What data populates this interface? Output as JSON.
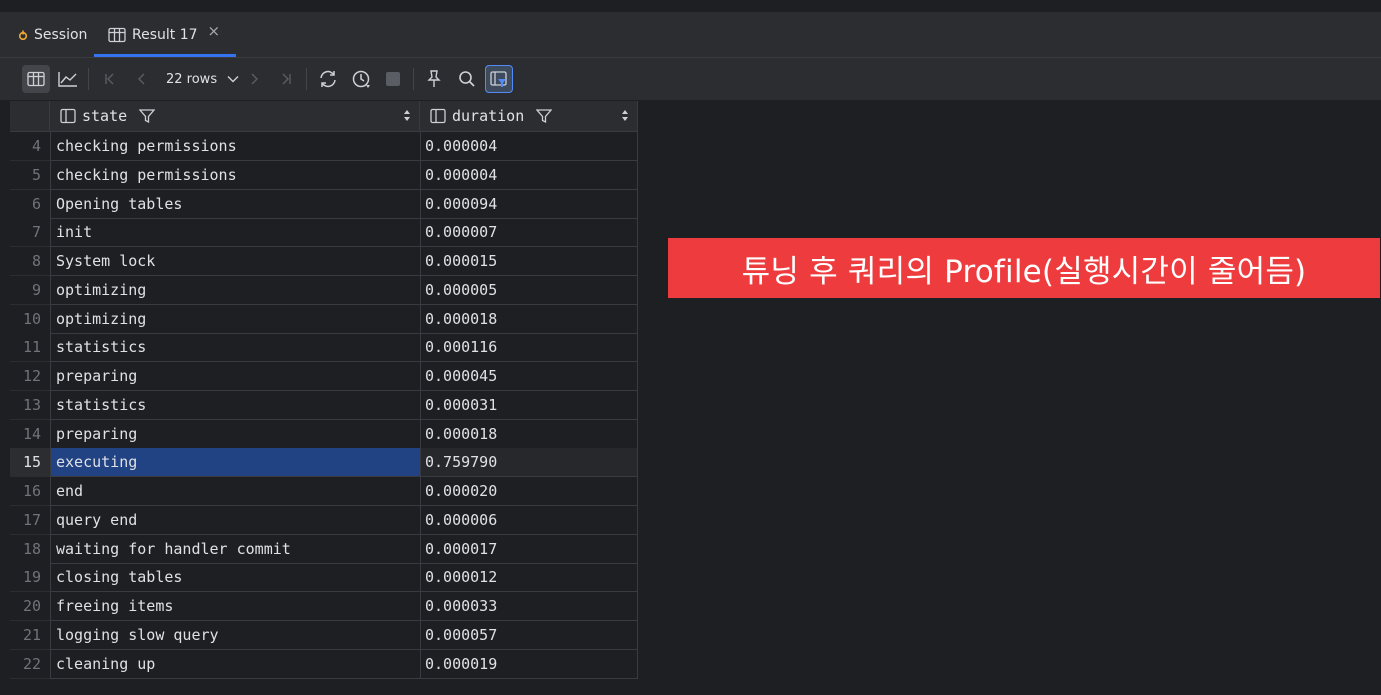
{
  "tabs": [
    {
      "label": "Session",
      "icon": "session-icon"
    },
    {
      "label": "Result 17",
      "icon": "table-icon",
      "close": "×"
    }
  ],
  "toolbar": {
    "rows_label": "22 rows",
    "icons": [
      "table-view-icon",
      "chart-view-icon",
      "first-page-icon",
      "prev-page-icon",
      "next-page-icon",
      "last-page-icon",
      "refresh-icon",
      "history-icon",
      "stop-icon",
      "pin-icon",
      "search-icon",
      "filter-panel-icon"
    ]
  },
  "grid": {
    "columns": [
      {
        "label": "state"
      },
      {
        "label": "duration"
      }
    ],
    "selected_row": "15",
    "rows": [
      {
        "num": "4",
        "state": "checking permissions",
        "duration": "0.000004"
      },
      {
        "num": "5",
        "state": "checking permissions",
        "duration": "0.000004"
      },
      {
        "num": "6",
        "state": "Opening tables",
        "duration": "0.000094"
      },
      {
        "num": "7",
        "state": "init",
        "duration": "0.000007"
      },
      {
        "num": "8",
        "state": "System lock",
        "duration": "0.000015"
      },
      {
        "num": "9",
        "state": "optimizing",
        "duration": "0.000005"
      },
      {
        "num": "10",
        "state": "optimizing",
        "duration": "0.000018"
      },
      {
        "num": "11",
        "state": "statistics",
        "duration": "0.000116"
      },
      {
        "num": "12",
        "state": "preparing",
        "duration": "0.000045"
      },
      {
        "num": "13",
        "state": "statistics",
        "duration": "0.000031"
      },
      {
        "num": "14",
        "state": "preparing",
        "duration": "0.000018"
      },
      {
        "num": "15",
        "state": "executing",
        "duration": "0.759790"
      },
      {
        "num": "16",
        "state": "end",
        "duration": "0.000020"
      },
      {
        "num": "17",
        "state": "query end",
        "duration": "0.000006"
      },
      {
        "num": "18",
        "state": "waiting for handler commit",
        "duration": "0.000017"
      },
      {
        "num": "19",
        "state": "closing tables",
        "duration": "0.000012"
      },
      {
        "num": "20",
        "state": "freeing items",
        "duration": "0.000033"
      },
      {
        "num": "21",
        "state": "logging slow query",
        "duration": "0.000057"
      },
      {
        "num": "22",
        "state": "cleaning up",
        "duration": "0.000019"
      }
    ]
  },
  "annotation": {
    "text": "튜닝 후 쿼리의 Profile(실행시간이 줄어듬)",
    "background": "#ee3b3e"
  }
}
